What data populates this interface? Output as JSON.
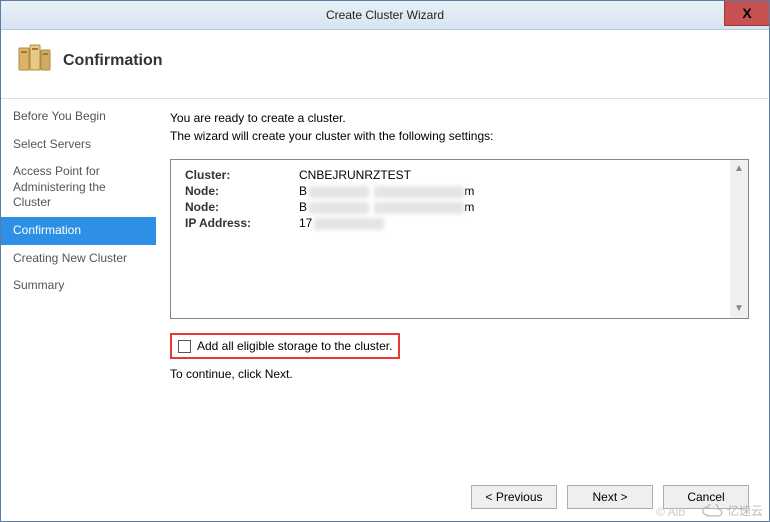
{
  "window": {
    "title": "Create Cluster Wizard",
    "close_glyph": "X"
  },
  "header": {
    "title": "Confirmation"
  },
  "sidebar": {
    "items": [
      {
        "label": "Before You Begin",
        "active": false
      },
      {
        "label": "Select Servers",
        "active": false
      },
      {
        "label": "Access Point for Administering the Cluster",
        "active": false
      },
      {
        "label": "Confirmation",
        "active": true
      },
      {
        "label": "Creating New Cluster",
        "active": false
      },
      {
        "label": "Summary",
        "active": false
      }
    ]
  },
  "content": {
    "intro_line1": "You are ready to create a cluster.",
    "intro_line2": "The wizard will create your cluster with the following settings:",
    "settings": [
      {
        "label": "Cluster:",
        "value_prefix": "CNBEJRUNRZTEST",
        "redacted_suffix": false
      },
      {
        "label": "Node:",
        "value_prefix": "B",
        "redacted_suffix": true,
        "suffix_hint": "m"
      },
      {
        "label": "Node:",
        "value_prefix": "B",
        "redacted_suffix": true,
        "suffix_hint": "m"
      },
      {
        "label": "IP Address:",
        "value_prefix": "17",
        "redacted_suffix": true
      }
    ],
    "checkbox_label": "Add all eligible storage to the cluster.",
    "checkbox_checked": false,
    "continue_text": "To continue, click Next."
  },
  "footer": {
    "previous_label": "< Previous",
    "next_label": "Next >",
    "cancel_label": "Cancel"
  },
  "watermark": {
    "left": "© Alb",
    "right": "亿速云"
  }
}
